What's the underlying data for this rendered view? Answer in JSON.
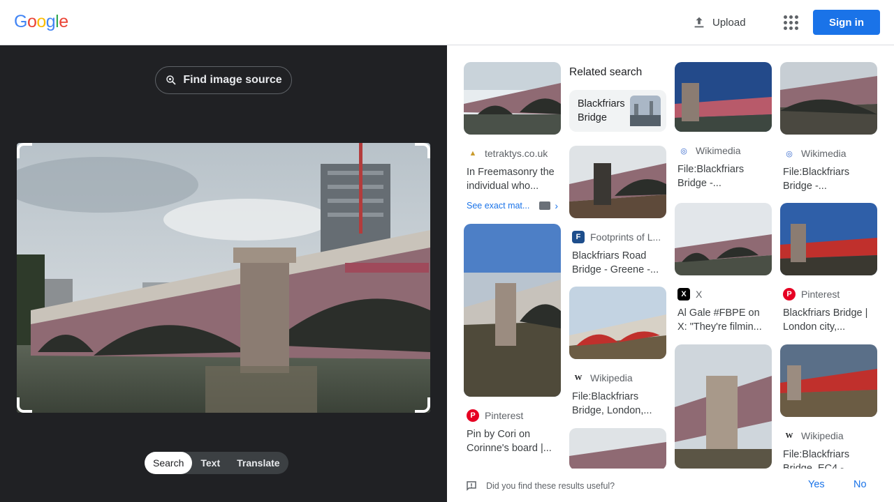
{
  "header": {
    "logo_letters": [
      "G",
      "o",
      "o",
      "g",
      "l",
      "e"
    ],
    "logo_colors": [
      "#4285f4",
      "#ea4335",
      "#fbbc05",
      "#4285f4",
      "#34a853",
      "#ea4335"
    ],
    "upload_label": "Upload",
    "signin_label": "Sign in"
  },
  "query_panel": {
    "find_source_label": "Find image source",
    "modes": [
      "Search",
      "Text",
      "Translate"
    ],
    "active_mode": "Search"
  },
  "results": {
    "related_title": "Related search",
    "related_chip_label": "Blackfriars Bridge",
    "exact_match_label": "See exact mat...",
    "cards": [
      {
        "id": "c1",
        "source": "tetraktys.co.uk",
        "title": "In Freemasonry the individual who..."
      },
      {
        "id": "c2",
        "source": "Pinterest",
        "title": "Pin by Cori on Corinne's board |..."
      },
      {
        "id": "c3",
        "source": "Footprints of L...",
        "title": "Blackfriars Road Bridge - Greene -..."
      },
      {
        "id": "c4",
        "source": "Wikipedia",
        "title": "File:Blackfriars Bridge, London,..."
      },
      {
        "id": "c5",
        "source": "Wikimedia",
        "title": "File:Blackfriars Bridge -..."
      },
      {
        "id": "c6",
        "source": "X",
        "title": "Al Gale #FBPE on X: \"They're filmin..."
      },
      {
        "id": "c7",
        "source": "Wikimedia",
        "title": "File:Blackfriars Bridge -..."
      },
      {
        "id": "c8",
        "source": "Pinterest",
        "title": "Blackfriars Bridge | London city,..."
      },
      {
        "id": "c9",
        "source": "Wikipedia",
        "title": "File:Blackfriars Bridge, EC4 -..."
      }
    ]
  },
  "footer": {
    "question": "Did you find these results useful?",
    "yes_label": "Yes",
    "no_label": "No"
  }
}
